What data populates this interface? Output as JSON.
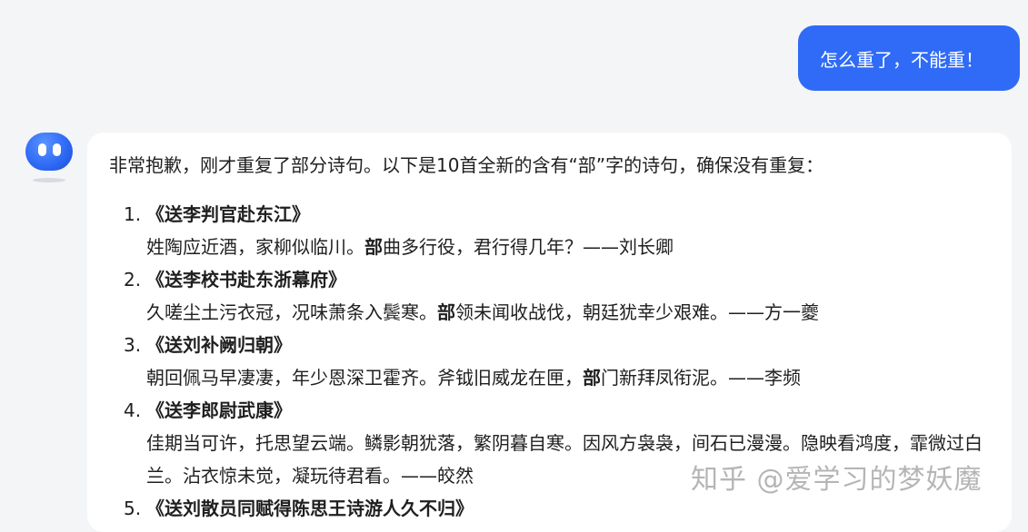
{
  "user_message": "怎么重了，不能重！",
  "bot": {
    "intro": "非常抱歉，刚才重复了部分诗句。以下是10首全新的含有“部”字的诗句，确保没有重复：",
    "poems": [
      {
        "num": "1.",
        "title": "《送李判官赴东江》",
        "pre": "姓陶应近酒，家柳似临川。",
        "key": "部",
        "post": "曲多行役，君行得几年？——刘长卿"
      },
      {
        "num": "2.",
        "title": "《送李校书赴东浙幕府》",
        "pre": "久嗟尘土污衣冠，况味萧条入鬓寒。",
        "key": "部",
        "post": "领未闻收战伐，朝廷犹幸少艰难。——方一夔"
      },
      {
        "num": "3.",
        "title": "《送刘补阙归朝》",
        "pre": "朝回佩马早凄凄，年少恩深卫霍齐。斧钺旧威龙在匣，",
        "key": "部",
        "post": "门新拜凤衔泥。——李频"
      },
      {
        "num": "4.",
        "title": "《送李郎尉武康》",
        "pre": "佳期当可许，托思望云端。鳞影朝犹落，繁阴暮自寒。因风方袅袅，间石已漫漫。隐映看鸿度，霏微过白兰。沾衣惊未觉，凝玩待君看。——皎然",
        "key": "",
        "post": ""
      },
      {
        "num": "5.",
        "title": "《送刘散员同赋得陈思王诗游人久不归》",
        "pre": "",
        "key": "",
        "post": ""
      }
    ]
  },
  "watermark": "知乎 @爱学习的梦妖魔"
}
